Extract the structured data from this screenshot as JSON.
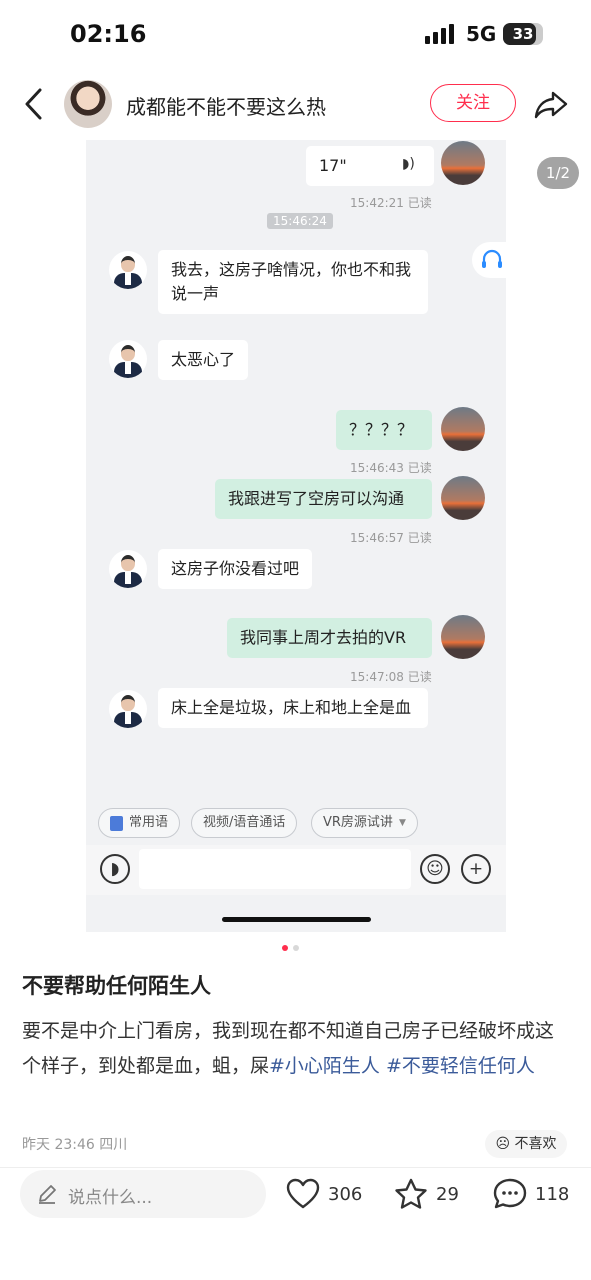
{
  "status": {
    "time": "02:16",
    "network": "5G",
    "battery": "33"
  },
  "header": {
    "title": "成都能不能不要这么热",
    "follow_label": "关注"
  },
  "image": {
    "page_indicator": "1/2",
    "chat": [
      {
        "kind": "voice",
        "text": "17\"",
        "time": "15:42:21 已读"
      },
      {
        "kind": "center_time",
        "text": "15:46:24"
      },
      {
        "kind": "in",
        "text": "我去，这房子啥情况，你也不和我说一声"
      },
      {
        "kind": "in",
        "text": "太恶心了"
      },
      {
        "kind": "out",
        "text": "？？？？",
        "time": "15:46:43 已读"
      },
      {
        "kind": "out",
        "text": "我跟进写了空房可以沟通",
        "time": "15:46:57 已读"
      },
      {
        "kind": "in",
        "text": "这房子你没看过吧"
      },
      {
        "kind": "out",
        "text": "我同事上周才去拍的VR",
        "time": "15:47:08 已读"
      },
      {
        "kind": "in",
        "text": "床上全是垃圾，床上和地上全是血"
      }
    ],
    "quick_replies": [
      "常用语",
      "视频/语音通话",
      "VR房源试讲"
    ]
  },
  "post": {
    "title": "不要帮助任何陌生人",
    "body": "要不是中介上门看房，我到现在都不知道自己房子已经破坏成这个样子，到处都是血，蛆，屎",
    "tags": [
      "#小心陌生人",
      "#不要轻信任何人"
    ],
    "meta": "昨天 23:46 四川",
    "dislike_label": "不喜欢"
  },
  "bottom": {
    "comment_placeholder": "说点什么...",
    "likes": "306",
    "collects": "29",
    "comments": "118"
  }
}
